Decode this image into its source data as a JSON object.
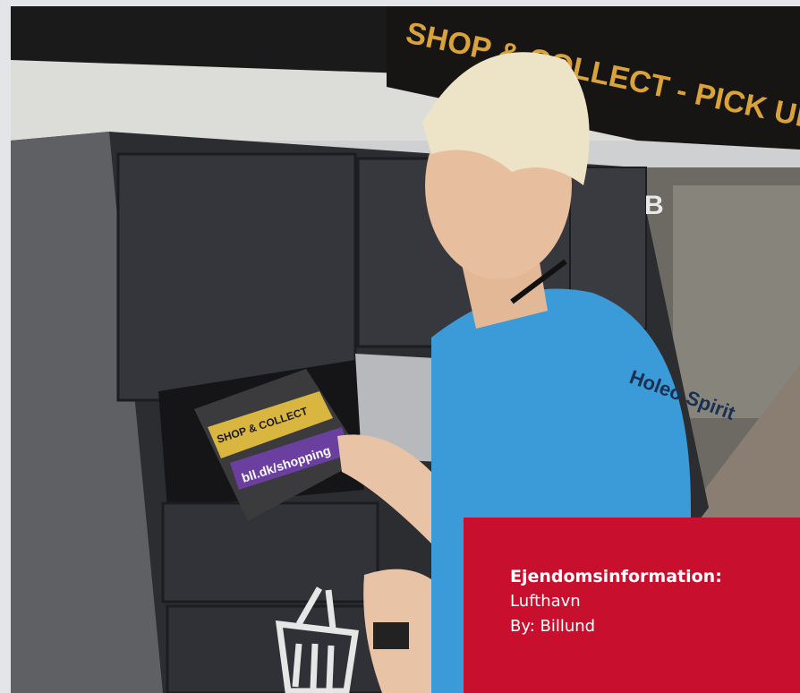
{
  "photo": {
    "sign_text": "SHOP & COLLECT - PICK UP POINT",
    "locker_letter": "B",
    "bag_text": "bll.dk/shopping",
    "bag_logo": "SHOP & COLLECT",
    "shirt_text": "Holeo Spirit",
    "icons": [
      "shopping-basket-icon"
    ]
  },
  "info_card": {
    "title": "Ejendomsinformation:",
    "line1": "Lufthavn",
    "line2": "By: Billund",
    "color": "#c8102e"
  }
}
